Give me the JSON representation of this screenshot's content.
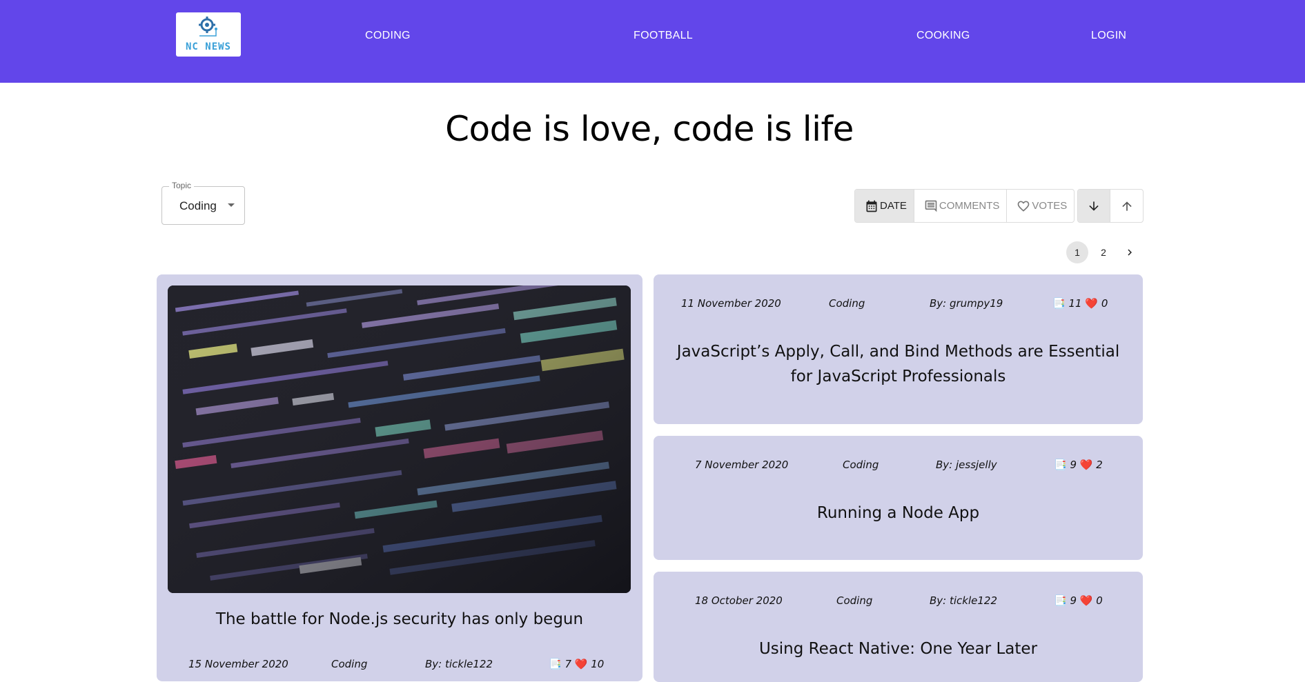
{
  "header": {
    "logo_text": "NC NEWS",
    "nav": [
      "CODING",
      "FOOTBALL",
      "COOKING",
      "LOGIN"
    ]
  },
  "page_title": "Code is love, code is life",
  "topic_select": {
    "legend": "Topic",
    "value": "Coding"
  },
  "sort": {
    "options": [
      "DATE",
      "COMMENTS",
      "VOTES"
    ],
    "active": "DATE",
    "order_active": "descending"
  },
  "pagination": {
    "pages": [
      "1",
      "2"
    ],
    "current": "1",
    "next_icon": "chevron-right-icon"
  },
  "colors": {
    "header_bg": "#6246ea",
    "card_bg": "#d1d1e9",
    "heart": "#e0242f"
  },
  "featured_article": {
    "title": "The battle for Node.js security has only begun",
    "date": "15 November 2020",
    "topic": "Coding",
    "author": "By: tickle122",
    "comments": "7",
    "votes": "10"
  },
  "articles": [
    {
      "date": "11 November 2020",
      "topic": "Coding",
      "author": "By: grumpy19",
      "comments": "11",
      "votes": "0",
      "title": "JavaScript’s Apply, Call, and Bind Methods are Essential for JavaScript Professionals"
    },
    {
      "date": "7 November 2020",
      "topic": "Coding",
      "author": "By: jessjelly",
      "comments": "9",
      "votes": "2",
      "title": "Running a Node App"
    },
    {
      "date": "18 October 2020",
      "topic": "Coding",
      "author": "By: tickle122",
      "comments": "9",
      "votes": "0",
      "title": "Using React Native: One Year Later"
    }
  ]
}
